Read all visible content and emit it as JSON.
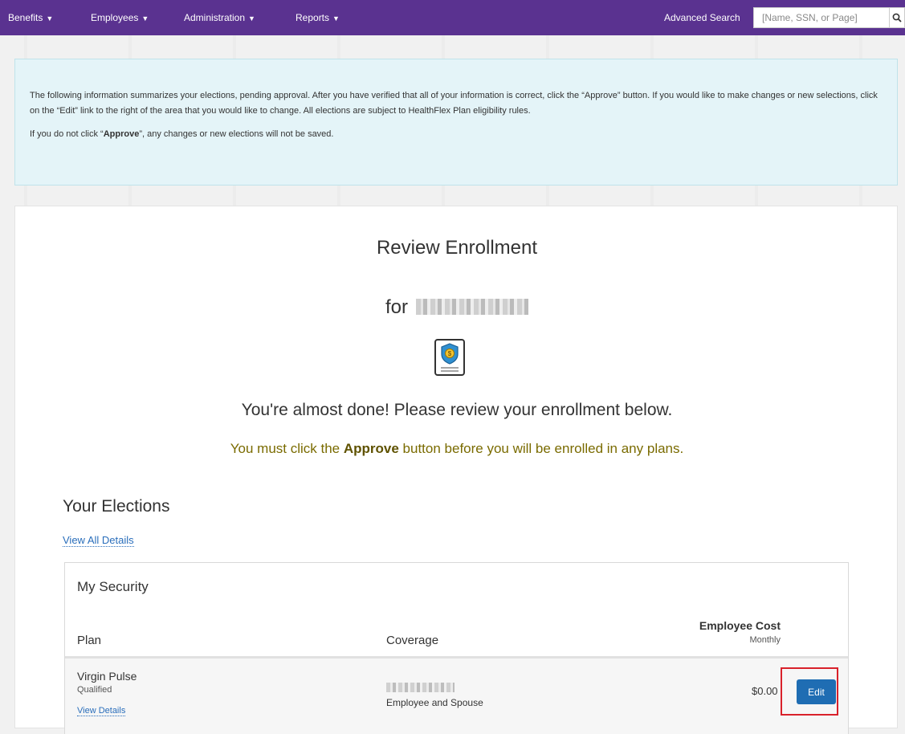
{
  "nav": {
    "items": [
      {
        "label": "Benefits",
        "x": 0
      },
      {
        "label": "Employees"
      },
      {
        "label": "Administration"
      },
      {
        "label": "Reports"
      }
    ],
    "advanced_search": "Advanced Search",
    "search_placeholder": "[Name, SSN, or Page]"
  },
  "info": {
    "paragraph1": "The following information summarizes your elections, pending approval. After you have verified that all of your information is correct, click the “Approve” button. If you would like to make changes or new selections, click on the “Edit” link to the right of the area that you would like to change.  All elections are subject to HealthFlex Plan eligibility rules.",
    "paragraph2_prefix": "If you do not click “",
    "paragraph2_bold": "Approve",
    "paragraph2_suffix": "”, any changes or new elections will not be saved."
  },
  "review": {
    "title": "Review Enrollment",
    "for_label": "for",
    "almost_done": "You're almost done! Please review your enrollment below.",
    "must_prefix": "You must click the ",
    "must_bold": "Approve",
    "must_suffix": " button before you will be enrolled in any plans."
  },
  "elections": {
    "heading": "Your Elections",
    "view_all": "View All Details",
    "panel_title": "My Security",
    "columns": {
      "plan": "Plan",
      "coverage": "Coverage",
      "cost": "Employee Cost",
      "cost_sub": "Monthly"
    },
    "rows": [
      {
        "plan": "Virgin Pulse",
        "status": "Qualified",
        "details": "View Details",
        "coverage_type": "Employee and Spouse",
        "cost": "$0.00",
        "edit": "Edit"
      }
    ]
  }
}
